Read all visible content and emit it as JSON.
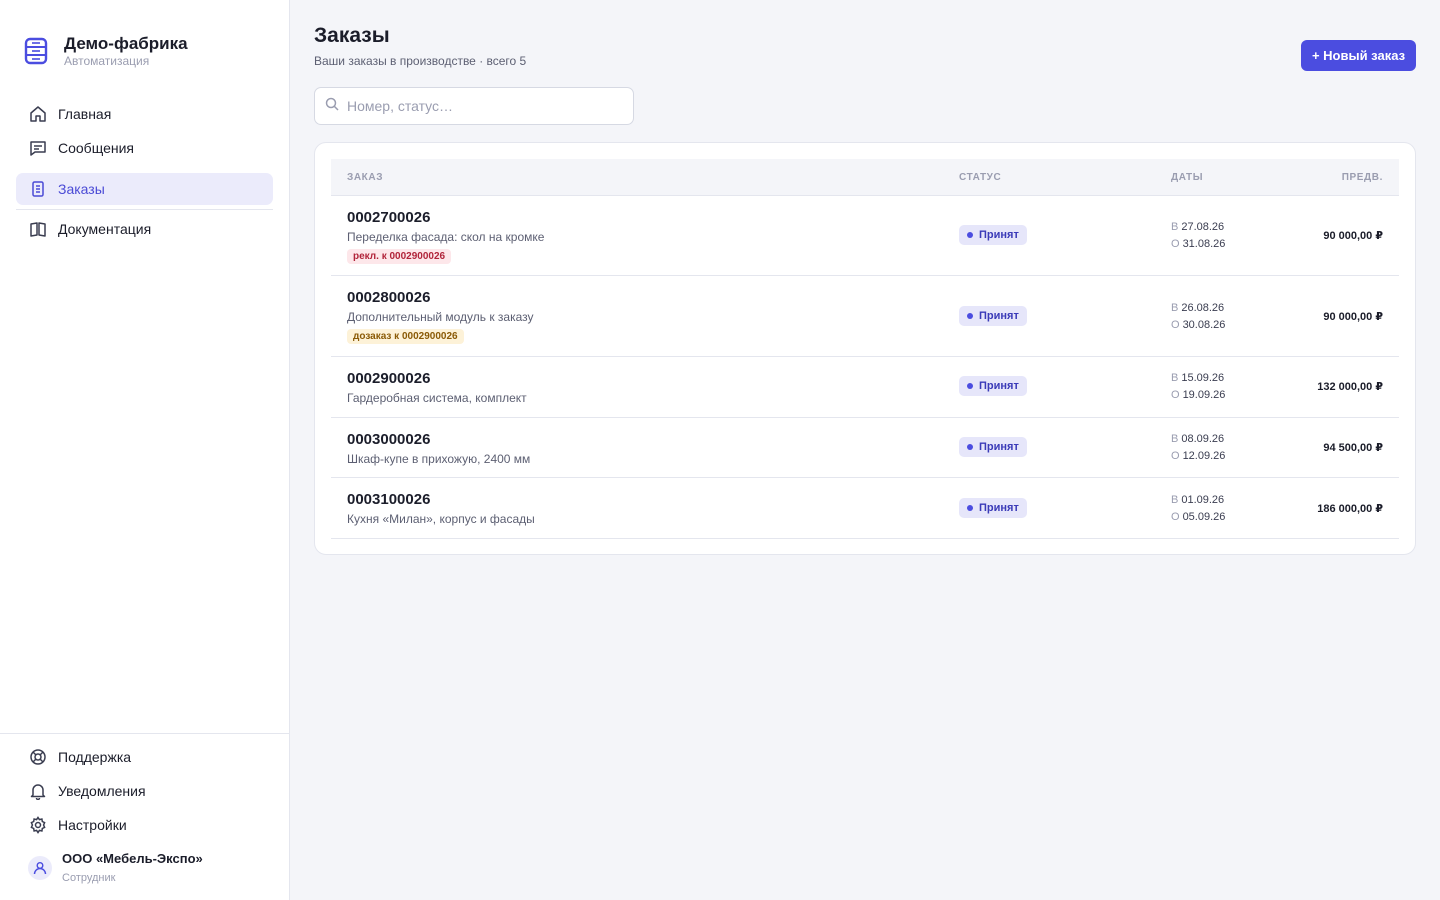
{
  "brand": {
    "title": "Демо-фабрика",
    "subtitle": "Автоматизация"
  },
  "nav": {
    "home": "Главная",
    "messages": "Сообщения",
    "orders": "Заказы",
    "docs": "Документация"
  },
  "footer_nav": {
    "support": "Поддержка",
    "notifications": "Уведомления",
    "settings": "Настройки"
  },
  "user": {
    "name": "ООО «Мебель-Экспо»",
    "role": "Сотрудник"
  },
  "page": {
    "title": "Заказы",
    "subtitle": "Ваши заказы в производстве · всего 5",
    "new_button": "+ Новый заказ",
    "search_placeholder": "Номер, статус…"
  },
  "table": {
    "columns": {
      "order": "ЗАКАЗ",
      "status": "СТАТУС",
      "dates": "ДАТЫ",
      "price": "ПРЕДВ."
    },
    "rows": [
      {
        "number": "0002700026",
        "description": "Переделка фасада: скол на кромке",
        "tag": "рекл. к 0002900026",
        "tag_type": "red",
        "status": "Принят",
        "date_b_prefix": "В",
        "date_b": "27.08.26",
        "date_o_prefix": "О",
        "date_o": "31.08.26",
        "price": "90 000,00 ₽"
      },
      {
        "number": "0002800026",
        "description": "Дополнительный модуль к заказу",
        "tag": "дозаказ к 0002900026",
        "tag_type": "yellow",
        "status": "Принят",
        "date_b_prefix": "В",
        "date_b": "26.08.26",
        "date_o_prefix": "О",
        "date_o": "30.08.26",
        "price": "90 000,00 ₽"
      },
      {
        "number": "0002900026",
        "description": "Гардеробная система, комплект",
        "status": "Принят",
        "date_b_prefix": "В",
        "date_b": "15.09.26",
        "date_o_prefix": "О",
        "date_o": "19.09.26",
        "price": "132 000,00 ₽"
      },
      {
        "number": "0003000026",
        "description": "Шкаф-купе в прихожую, 2400 мм",
        "status": "Принят",
        "date_b_prefix": "В",
        "date_b": "08.09.26",
        "date_o_prefix": "О",
        "date_o": "12.09.26",
        "price": "94 500,00 ₽"
      },
      {
        "number": "0003100026",
        "description": "Кухня «Милан», корпус и фасады",
        "status": "Принят",
        "date_b_prefix": "В",
        "date_b": "01.09.26",
        "date_o_prefix": "О",
        "date_o": "05.09.26",
        "price": "186 000,00 ₽"
      }
    ]
  },
  "colors": {
    "accent": "#4b4de0",
    "tag_red_bg": "#fde7ea",
    "tag_yellow_bg": "#fdf2d8",
    "status_bg": "#e6e6fa"
  }
}
